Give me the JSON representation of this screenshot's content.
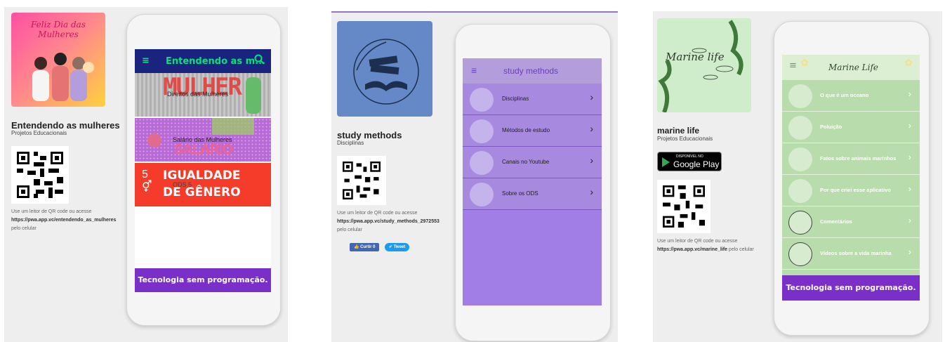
{
  "cards": [
    {
      "thumb_title": "Feliz Dia das Mulheres",
      "name": "Entendendo as mulheres",
      "category": "Projetos Educacionais",
      "qr_hint": "Use um leitor de QR code ou acesse",
      "url": "https://pwa.app.vc/entendendo_as_mulheres",
      "suffix": "pelo celular",
      "phone": {
        "header_title": "Entendendo as m...",
        "banners": [
          {
            "big": "MULHER",
            "label": "Direitos das Mulheres"
          },
          {
            "big": "SALARIO",
            "label": "Salário das Mulheres"
          },
          {
            "big": "IGUALDADE DE GÊNERO",
            "label": "ODS 5"
          }
        ],
        "footer": "Tecnologia sem programação."
      }
    },
    {
      "name": "study methods",
      "category": "Disciplinas",
      "qr_hint": "Use um leitor de QR code ou acesse",
      "url": "https://pwa.app.vc/study_methods_2972553",
      "suffix": "pelo celular",
      "like_label": "Curtir 0",
      "tweet_label": "Tweet",
      "phone": {
        "header_title": "study methods",
        "items": [
          "Disciplinas",
          "Métodos de estudo",
          "Canais no Youtube",
          "Sobre os ODS"
        ]
      }
    },
    {
      "thumb_title": "Marine life",
      "name": "marine life",
      "category": "Projetos Educacionais",
      "store_small": "DISPONÍVEL NO",
      "store_big": "Google Play",
      "qr_hint": "Use um leitor de QR code ou acesse",
      "url": "https://pwa.app.vc/marine_life",
      "suffix": "pelo celular",
      "phone": {
        "header_title": "Marine Life",
        "items": [
          "O que é um oceano",
          "Poluição",
          "Fatos sobre animais marinhos",
          "Por que criei esse aplicativo",
          "Comentários",
          "Vídeos sobre a vida marinha"
        ],
        "footer": "Tecnologia sem programação."
      }
    }
  ]
}
